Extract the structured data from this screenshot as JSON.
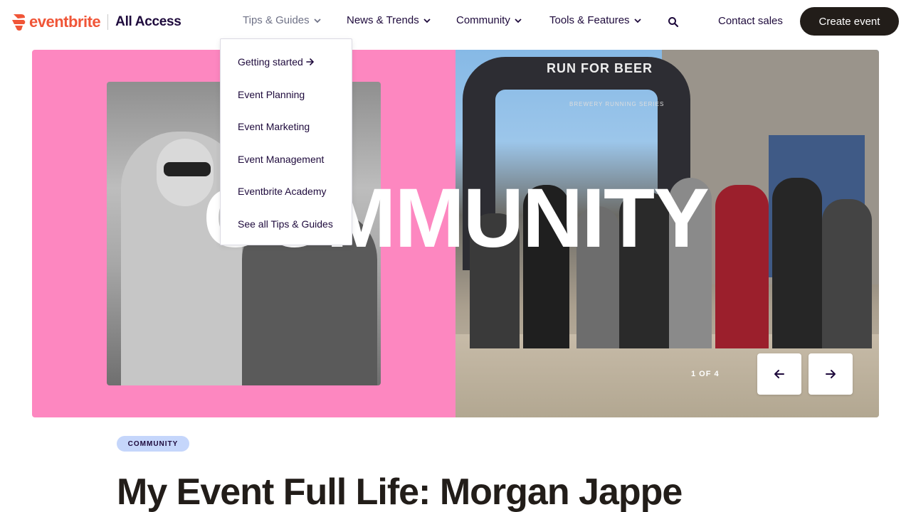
{
  "header": {
    "logo_text": "eventbrite",
    "logo_subtitle": "All Access",
    "nav": [
      {
        "label": "Tips & Guides",
        "active": true
      },
      {
        "label": "News & Trends",
        "active": false
      },
      {
        "label": "Community",
        "active": false
      },
      {
        "label": "Tools & Features",
        "active": false
      }
    ],
    "search_icon": "search-icon",
    "contact_label": "Contact sales",
    "create_label": "Create event"
  },
  "dropdown": {
    "items": [
      "Getting started",
      "Event Planning",
      "Event Marketing",
      "Event Management",
      "Eventbrite Academy",
      "See all Tips & Guides"
    ]
  },
  "hero": {
    "overlay_word": "COMMUNITY",
    "arch_text": "RUN FOR BEER",
    "arch_subtext": "BREWERY RUNNING SERIES",
    "pager": "1 OF 4",
    "prev_icon": "arrow-left-icon",
    "next_icon": "arrow-right-icon"
  },
  "article": {
    "category": "COMMUNITY",
    "title": "My Event Full Life: Morgan Jappe"
  },
  "colors": {
    "brand": "#f05537",
    "pink": "#fd87c0",
    "dark": "#221d19",
    "badge": "#c5d6fb"
  }
}
